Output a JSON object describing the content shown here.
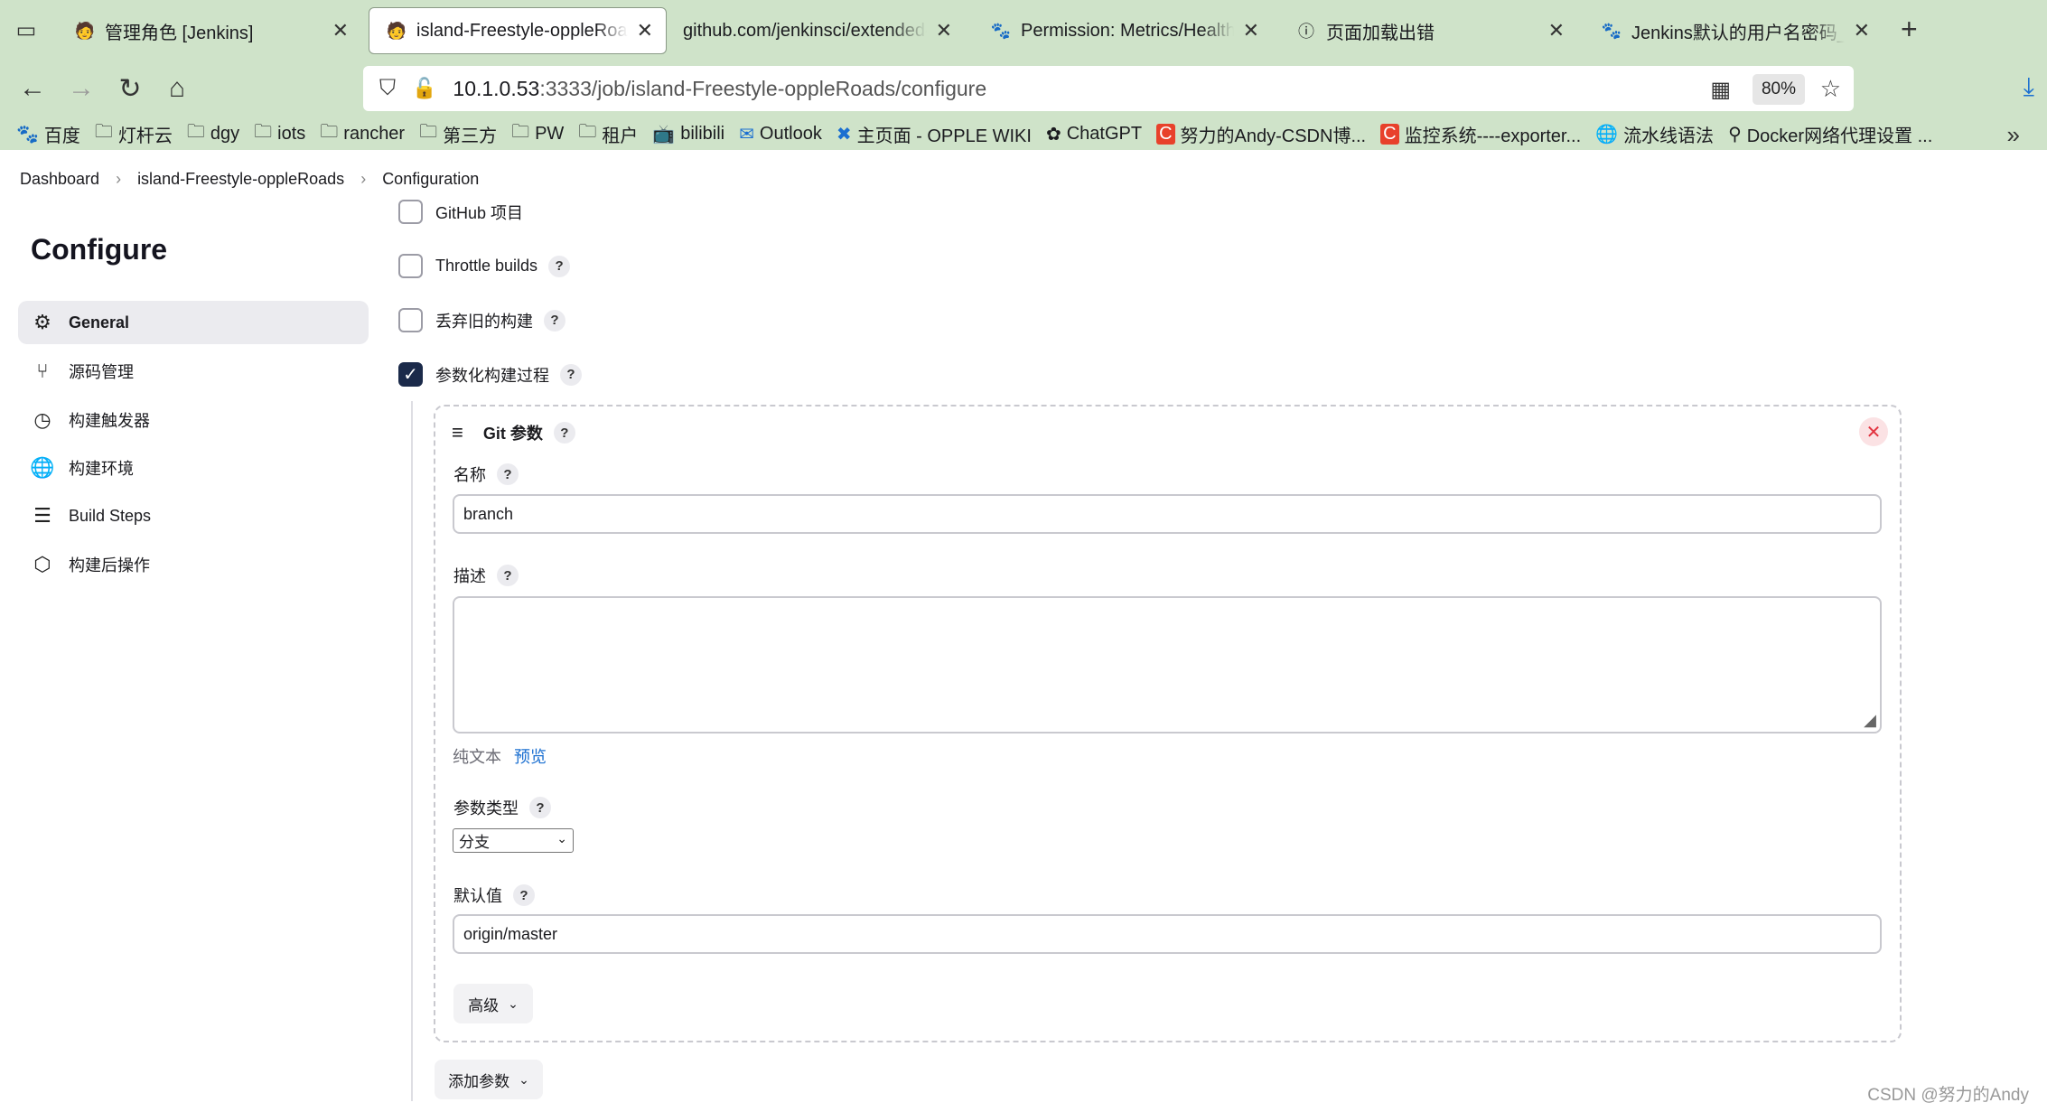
{
  "browser": {
    "tabs": [
      {
        "title": "管理角色 [Jenkins]",
        "favicon": "jenkins-icon",
        "active": false
      },
      {
        "title": "island-Freestyle-oppleRoads",
        "favicon": "jenkins-icon",
        "active": true
      },
      {
        "title": "github.com/jenkinsci/extended-c",
        "favicon": "",
        "active": false
      },
      {
        "title": "Permission: Metrics/HealthCh",
        "favicon": "baidu-icon",
        "active": false
      },
      {
        "title": "页面加载出错",
        "favicon": "info-icon",
        "active": false
      },
      {
        "title": "Jenkins默认的用户名密码_百度",
        "favicon": "baidu-icon",
        "active": false
      }
    ],
    "url_host": "10.1.0.53",
    "url_path": ":3333/job/island-Freestyle-oppleRoads/configure",
    "zoom": "80%",
    "bookmarks": [
      {
        "label": "百度",
        "icon": "baidu-icon"
      },
      {
        "label": "灯杆云",
        "icon": "folder-icon"
      },
      {
        "label": "dgy",
        "icon": "folder-icon"
      },
      {
        "label": "iots",
        "icon": "folder-icon"
      },
      {
        "label": "rancher",
        "icon": "folder-icon"
      },
      {
        "label": "第三方",
        "icon": "folder-icon"
      },
      {
        "label": "PW",
        "icon": "folder-icon"
      },
      {
        "label": "租户",
        "icon": "folder-icon"
      },
      {
        "label": "bilibili",
        "icon": "bilibili-icon"
      },
      {
        "label": "Outlook",
        "icon": "outlook-icon"
      },
      {
        "label": "主页面 - OPPLE WIKI",
        "icon": "confluence-icon"
      },
      {
        "label": "ChatGPT",
        "icon": "openai-icon"
      },
      {
        "label": "努力的Andy-CSDN博...",
        "icon": "csdn-icon"
      },
      {
        "label": "监控系统----exporter...",
        "icon": "csdn-icon"
      },
      {
        "label": "流水线语法",
        "icon": "globe-icon"
      },
      {
        "label": "Docker网络代理设置 ...",
        "icon": "link-icon"
      }
    ]
  },
  "breadcrumb": [
    "Dashboard",
    "island-Freestyle-oppleRoads",
    "Configuration"
  ],
  "sidebar": {
    "title": "Configure",
    "items": [
      {
        "label": "General",
        "icon": "gear-icon",
        "active": true
      },
      {
        "label": "源码管理",
        "icon": "branch-icon",
        "active": false
      },
      {
        "label": "构建触发器",
        "icon": "clock-icon",
        "active": false
      },
      {
        "label": "构建环境",
        "icon": "globe-icon",
        "active": false
      },
      {
        "label": "Build Steps",
        "icon": "list-icon",
        "active": false
      },
      {
        "label": "构建后操作",
        "icon": "package-icon",
        "active": false
      }
    ]
  },
  "options": [
    {
      "label": "GitHub 项目",
      "checked": false,
      "help": false
    },
    {
      "label": "Throttle builds",
      "checked": false,
      "help": true
    },
    {
      "label": "丢弃旧的构建",
      "checked": false,
      "help": true
    },
    {
      "label": "参数化构建过程",
      "checked": true,
      "help": true
    }
  ],
  "git_param": {
    "title": "Git 参数",
    "name_label": "名称",
    "name_value": "branch",
    "desc_label": "描述",
    "desc_value": "",
    "plain_text": "纯文本",
    "preview": "预览",
    "type_label": "参数类型",
    "type_value": "分支",
    "default_label": "默认值",
    "default_value": "origin/master",
    "advanced": "高级"
  },
  "add_param": "添加参数",
  "help_mark": "?",
  "watermark": "CSDN @努力的Andy"
}
